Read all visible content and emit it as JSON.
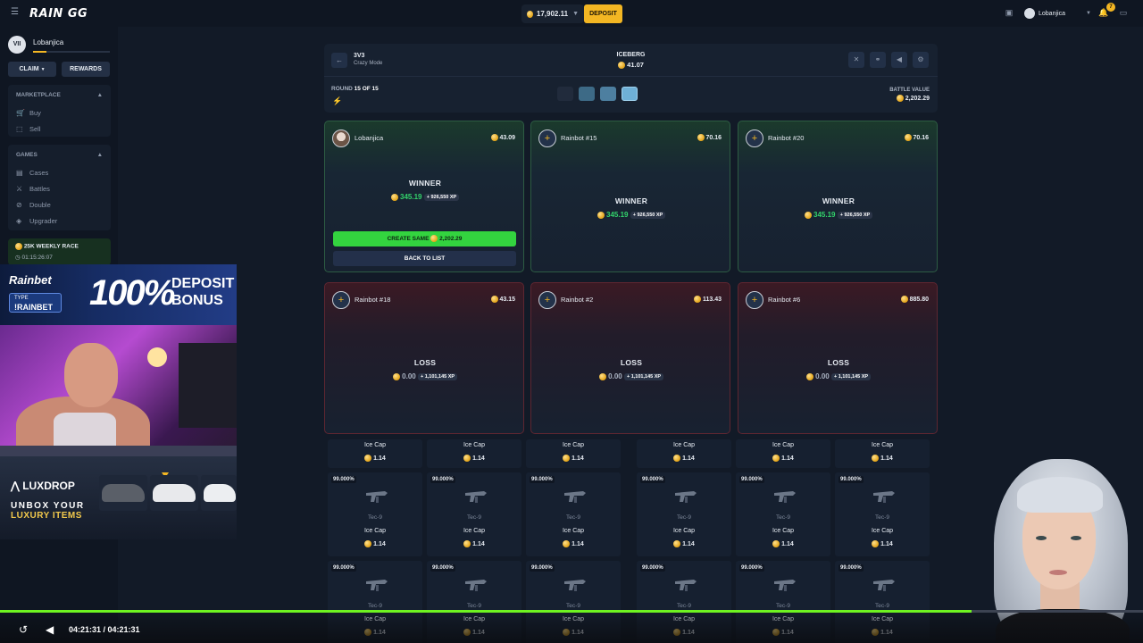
{
  "topbar": {
    "logo": "RAIN GG",
    "balance": "17,902.11",
    "deposit_label": "DEPOSIT",
    "username": "Lobanjica",
    "notif_count": "7",
    "icons": [
      "menu-icon",
      "chest-icon",
      "bell-icon",
      "chat-icon"
    ]
  },
  "sidebar": {
    "level": "VII",
    "username": "Lobanjica",
    "xp_fraction": 0.18,
    "claim_label": "CLAIM",
    "rewards_label": "REWARDS",
    "marketplace": {
      "title": "MARKETPLACE",
      "items": [
        {
          "label": "Buy",
          "icon": "cart-icon"
        },
        {
          "label": "Sell",
          "icon": "sell-icon"
        }
      ]
    },
    "games": {
      "title": "GAMES",
      "items": [
        {
          "label": "Cases",
          "icon": "case-icon"
        },
        {
          "label": "Battles",
          "icon": "swords-icon"
        },
        {
          "label": "Double",
          "icon": "double-icon"
        },
        {
          "label": "Upgrader",
          "icon": "upgrader-icon"
        }
      ]
    },
    "race": {
      "title": "25K WEEKLY RACE",
      "timer": "01:15:26:07"
    }
  },
  "ads": {
    "rainbet": {
      "brand": "Rainbet",
      "type_label": "TYPE",
      "command": "!RAINBET",
      "big": "100%",
      "line1": "DEPOSIT",
      "line2": "BONUS"
    },
    "luxdrop": {
      "brand": "LUXDROP",
      "line1": "UNBOX YOUR",
      "line2": "LUXURY ITEMS"
    }
  },
  "battle": {
    "mode_title": "3V3",
    "mode_sub": "Crazy Mode",
    "case_name": "ICEBERG",
    "case_price": "41.07",
    "round_label": "ROUND",
    "round_value": "15 OF 15",
    "value_label": "BATTLE VALUE",
    "value": "2,202.29",
    "header_icons": [
      "tools-icon",
      "link-icon",
      "sound-icon",
      "settings-icon"
    ]
  },
  "players": [
    {
      "name": "Lobanjica",
      "amount": "43.09",
      "result": "WINNER",
      "won": "345.19",
      "xp": "+ 926,550 XP",
      "status": "win"
    },
    {
      "name": "Rainbot #15",
      "amount": "70.16",
      "result": "WINNER",
      "won": "345.19",
      "xp": "+ 926,550 XP",
      "status": "win"
    },
    {
      "name": "Rainbot #20",
      "amount": "70.16",
      "result": "WINNER",
      "won": "345.19",
      "xp": "+ 926,550 XP",
      "status": "win"
    },
    {
      "name": "Rainbot #18",
      "amount": "43.15",
      "result": "LOSS",
      "won": "0.00",
      "xp": "+ 1,101,145 XP",
      "status": "loss"
    },
    {
      "name": "Rainbot #2",
      "amount": "113.43",
      "result": "LOSS",
      "won": "0.00",
      "xp": "+ 1,101,145 XP",
      "status": "loss"
    },
    {
      "name": "Rainbot #6",
      "amount": "885.80",
      "result": "LOSS",
      "won": "0.00",
      "xp": "+ 1,101,145 XP",
      "status": "loss"
    }
  ],
  "actions": {
    "create_label": "CREATE SAME",
    "create_amount": "2,202.29",
    "back_label": "BACK TO LIST"
  },
  "items": {
    "name": "Ice Cap",
    "price": "1.14",
    "odds": "99.000%",
    "type": "Tec-9"
  },
  "player_bar": {
    "time": "04:21:31 / 04:21:31",
    "progress": 0.85
  }
}
